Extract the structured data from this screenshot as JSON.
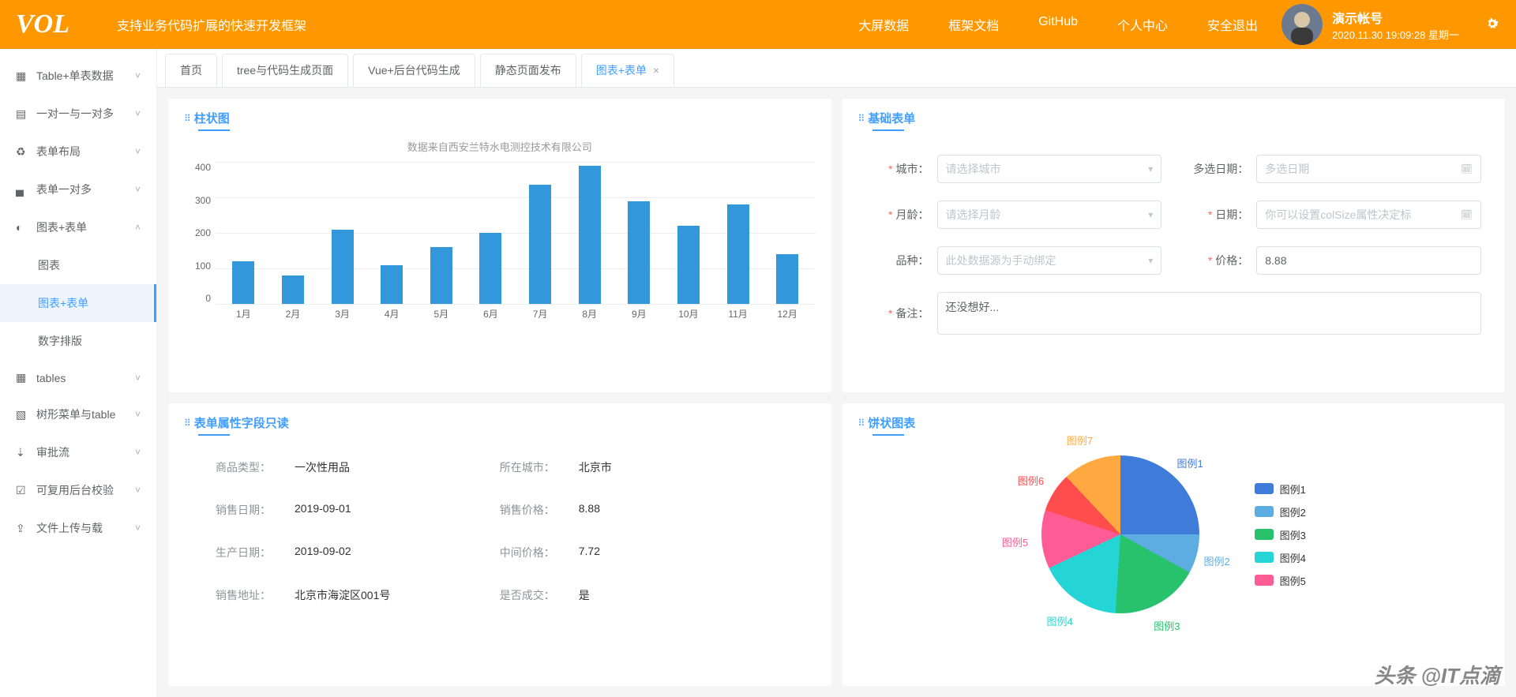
{
  "header": {
    "logo": "VOL",
    "subtitle": "支持业务代码扩展的快速开发框架",
    "nav": [
      "大屏数据",
      "框架文档",
      "GitHub",
      "个人中心",
      "安全退出"
    ],
    "user_name": "演示帐号",
    "datetime": "2020.11.30 19:09:28 星期一"
  },
  "sidebar": {
    "items": [
      {
        "icon": "grid",
        "label": "Table+单表数据",
        "expanded": false
      },
      {
        "icon": "table",
        "label": "一对一与一对多",
        "expanded": false
      },
      {
        "icon": "recycle",
        "label": "表单布局",
        "expanded": false
      },
      {
        "icon": "bars",
        "label": "表单一对多",
        "expanded": false
      },
      {
        "icon": "pie",
        "label": "图表+表单",
        "expanded": true,
        "children": [
          {
            "label": "图表",
            "active": false
          },
          {
            "label": "图表+表单",
            "active": true
          },
          {
            "label": "数字排版",
            "active": false
          }
        ]
      },
      {
        "icon": "grid",
        "label": "tables",
        "expanded": false
      },
      {
        "icon": "image",
        "label": "树形菜单与table",
        "expanded": false
      },
      {
        "icon": "flow",
        "label": "审批流",
        "expanded": false
      },
      {
        "icon": "check",
        "label": "可复用后台校验",
        "expanded": false
      },
      {
        "icon": "upload",
        "label": "文件上传与载",
        "expanded": false
      }
    ]
  },
  "tabs": [
    {
      "label": "首页",
      "closable": false
    },
    {
      "label": "tree与代码生成页面",
      "closable": false
    },
    {
      "label": "Vue+后台代码生成",
      "closable": false
    },
    {
      "label": "静态页面发布",
      "closable": false
    },
    {
      "label": "图表+表单",
      "closable": true,
      "active": true
    }
  ],
  "panels": {
    "bar_title": "柱状图",
    "form_title": "基础表单",
    "readonly_title": "表单属性字段只读",
    "pie_title": "饼状图表"
  },
  "form": {
    "city": {
      "label": "城市：",
      "placeholder": "请选择城市",
      "required": true
    },
    "multi_date": {
      "label": "多选日期：",
      "placeholder": "多选日期",
      "required": false
    },
    "age": {
      "label": "月龄：",
      "placeholder": "请选择月龄",
      "required": true
    },
    "date": {
      "label": "日期：",
      "placeholder": "你可以设置colSize属性决定标",
      "required": true
    },
    "breed": {
      "label": "品种：",
      "placeholder": "此处数据源为手动绑定",
      "required": false
    },
    "price": {
      "label": "价格：",
      "value": "8.88",
      "required": true
    },
    "remark": {
      "label": "备注：",
      "value": "还没想好...",
      "required": true
    }
  },
  "readonly": [
    {
      "label": "商品类型：",
      "value": "一次性用品"
    },
    {
      "label": "所在城市：",
      "value": "北京市"
    },
    {
      "label": "销售日期：",
      "value": "2019-09-01"
    },
    {
      "label": "销售价格：",
      "value": "8.88"
    },
    {
      "label": "生产日期：",
      "value": "2019-09-02"
    },
    {
      "label": "中间价格：",
      "value": "7.72"
    },
    {
      "label": "销售地址：",
      "value": "北京市海淀区001号"
    },
    {
      "label": "是否成交：",
      "value": "是"
    }
  ],
  "chart_data": {
    "type": "bar",
    "subtitle": "数据来自西安兰特水电测控技术有限公司",
    "categories": [
      "1月",
      "2月",
      "3月",
      "4月",
      "5月",
      "6月",
      "7月",
      "8月",
      "9月",
      "10月",
      "11月",
      "12月"
    ],
    "values": [
      120,
      80,
      210,
      110,
      160,
      200,
      335,
      390,
      290,
      220,
      280,
      140
    ],
    "ylim": [
      0,
      400
    ],
    "yticks": [
      0,
      100,
      200,
      300,
      400
    ]
  },
  "pie_data": {
    "type": "pie",
    "series": [
      {
        "name": "图例1",
        "value": 25,
        "color": "#3f7bd9"
      },
      {
        "name": "图例2",
        "value": 8,
        "color": "#5dade2"
      },
      {
        "name": "图例3",
        "value": 18,
        "color": "#27c26b"
      },
      {
        "name": "图例4",
        "value": 17,
        "color": "#25d5d5"
      },
      {
        "name": "图例5",
        "value": 12,
        "color": "#ff5b94"
      },
      {
        "name": "图例6",
        "value": 8,
        "color": "#ff4d4d"
      },
      {
        "name": "图例7",
        "value": 12,
        "color": "#ffa940"
      }
    ],
    "legend": [
      "图例1",
      "图例2",
      "图例3",
      "图例4",
      "图例5"
    ]
  },
  "watermark": "头条 @IT点滴"
}
